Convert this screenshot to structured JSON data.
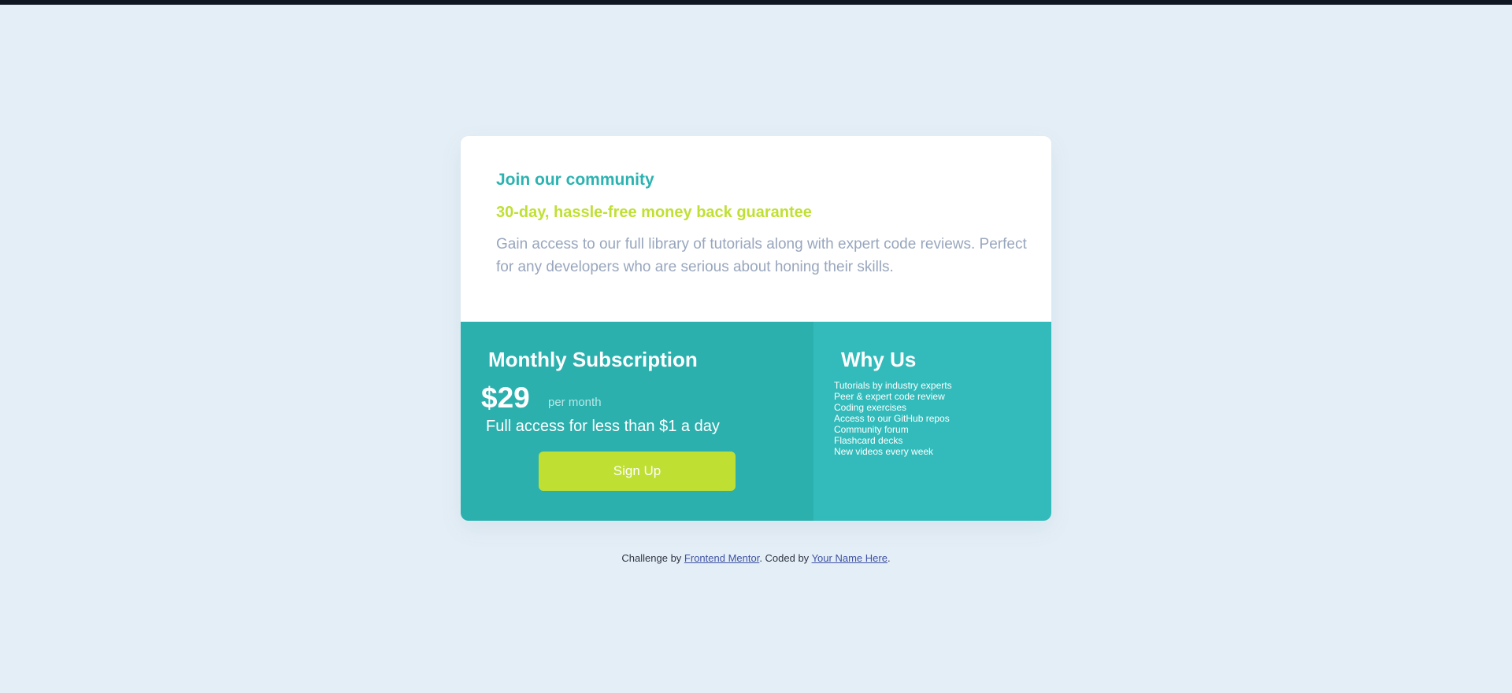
{
  "colors": {
    "page_background": "#e4eef6",
    "top_strip": "#111722",
    "card_white": "#ffffff",
    "cyan_dark": "#2bb0ae",
    "cyan_light": "#33bbbb",
    "join_title": "#2bb3b1",
    "lime": "#bfe033",
    "gray_text": "#98a6bd",
    "link": "#3e52a3"
  },
  "card": {
    "top": {
      "title": "Join our community",
      "guarantee": "30-day, hassle-free money back guarantee",
      "description": "Gain access to our full library of tutorials along with expert code reviews. Perfect for any developers who are serious about honing their skills."
    },
    "subscription": {
      "title": "Monthly Subscription",
      "price": "$29",
      "period": "per month",
      "tagline": "Full access for less than $1 a day",
      "button_label": "Sign Up"
    },
    "why_us": {
      "title": "Why Us",
      "items": [
        "Tutorials by industry experts",
        "Peer & expert code review",
        "Coding exercises",
        "Access to our GitHub repos",
        "Community forum",
        "Flashcard decks",
        "New videos every week"
      ]
    }
  },
  "attribution": {
    "prefix": "Challenge by ",
    "link1_text": "Frontend Mentor",
    "middle": ". Coded by ",
    "link2_text": "Your Name Here",
    "suffix": "."
  }
}
